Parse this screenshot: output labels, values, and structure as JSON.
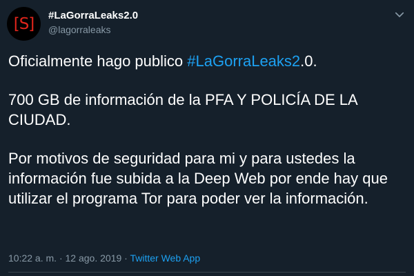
{
  "author": {
    "display_name": "#LaGorraLeaks2.0",
    "handle": "@lagorraleaks",
    "avatar_text": "[S]"
  },
  "menu": {
    "icon": "chevron-down-icon"
  },
  "tweet": {
    "line1_prefix": "Oficialmente hago publico ",
    "line1_hashtag": "#LaGorraLeaks2",
    "line1_suffix": ".0.",
    "paragraph2": "700 GB de información de la PFA Y POLICÍA DE LA CIUDAD.",
    "paragraph3": "Por motivos de seguridad para mi y para ustedes la información fue subida a la Deep Web por ende hay que utilizar el programa Tor para poder ver la información."
  },
  "meta": {
    "time": "10:22 a. m.",
    "separator": "·",
    "date": "12 ago. 2019",
    "source": "Twitter Web App"
  },
  "colors": {
    "background": "#15202b",
    "accent": "#1da1f2",
    "secondary_text": "#8899a6",
    "avatar_mark": "#e0251b"
  }
}
